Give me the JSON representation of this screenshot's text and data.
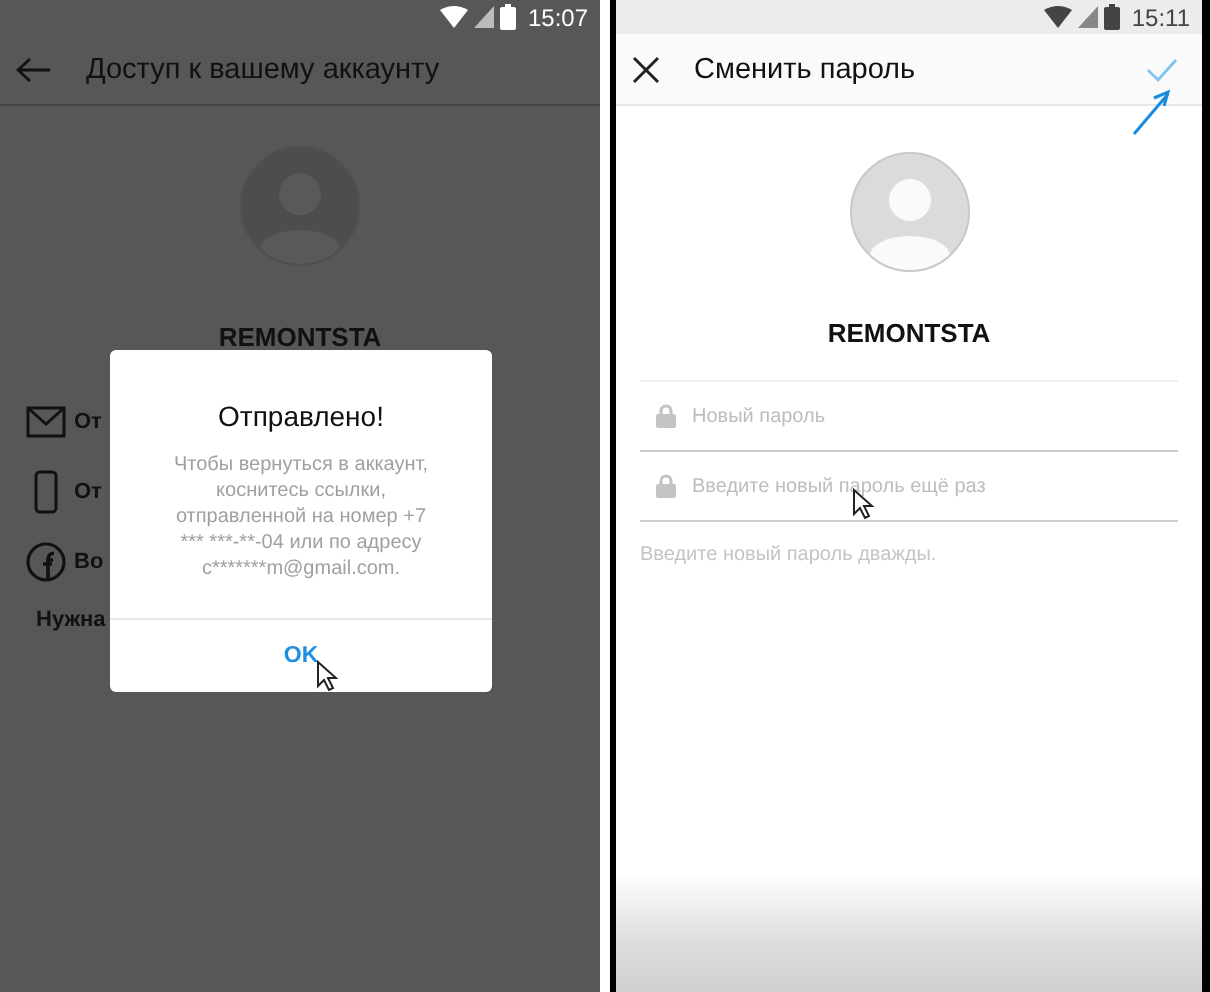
{
  "screens": [
    {
      "kind": "account_access",
      "status_time": "15:07",
      "title": "Доступ к вашему аккаунту",
      "username": "REMONTSTA",
      "options": [
        {
          "kind": "mail",
          "label": "От"
        },
        {
          "kind": "phone",
          "label": "От"
        },
        {
          "kind": "facebook",
          "label": "Во"
        }
      ],
      "help": "Нужна",
      "dialog": {
        "title": "Отправлено!",
        "message": "Чтобы вернуться в аккаунт, коснитесь ссылки, отправленной на номер +7 *** ***-**-04 или по адресу c*******m@gmail.com.",
        "button": "OK"
      }
    },
    {
      "kind": "change_password",
      "status_time": "15:11",
      "title": "Сменить пароль",
      "username": "REMONTSTA",
      "fields": [
        {
          "placeholder": "Новый пароль"
        },
        {
          "placeholder": "Введите новый пароль ещё раз"
        }
      ],
      "hint": "Введите новый пароль дважды."
    }
  ]
}
